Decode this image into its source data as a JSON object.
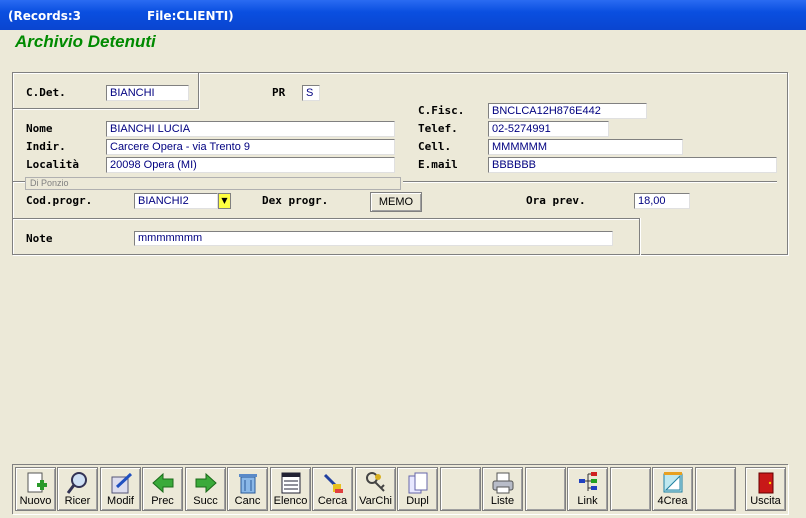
{
  "titlebar": {
    "records": "(Records:3",
    "file": "File:CLIENTI)"
  },
  "app_title": "Archivio Detenuti",
  "form": {
    "cdet_label": "C.Det.",
    "cdet_value": "BIANCHI",
    "pr_label": "PR",
    "pr_value": "S",
    "cfisc_label": "C.Fisc.",
    "cfisc_value": "BNCLCA12H876E442",
    "nome_label": "Nome",
    "nome_value": "BIANCHI LUCIA",
    "telef_label": "Telef.",
    "telef_value": "02-5274991",
    "indir_label": "Indir.",
    "indir_value": "Carcere Opera - via Trento 9",
    "cell_label": "Cell.",
    "cell_value": "MMMMMM",
    "localita_label": "Località",
    "localita_value": "20098  Opera (MI)",
    "email_label": "E.mail",
    "email_value": "BBBBBB",
    "group_caption": "Di Ponzio",
    "codprogr_label": "Cod.progr.",
    "codprogr_value": "BIANCHI2",
    "dexprogr_label": "Dex progr.",
    "memo_label": "MEMO",
    "oraprev_label": "Ora prev.",
    "oraprev_value": "18,00",
    "note_label": "Note",
    "note_value": "mmmmmmm"
  },
  "toolbar": {
    "buttons": [
      {
        "label": "Nuovo",
        "icon": "new-document-icon"
      },
      {
        "label": "Ricer",
        "icon": "magnifier-icon"
      },
      {
        "label": "Modif",
        "icon": "edit-document-icon"
      },
      {
        "label": "Prec",
        "icon": "arrow-left-icon"
      },
      {
        "label": "Succ",
        "icon": "arrow-right-icon"
      },
      {
        "label": "Canc",
        "icon": "trash-icon"
      },
      {
        "label": "Elenco",
        "icon": "list-icon"
      },
      {
        "label": "Cerca",
        "icon": "find-icon"
      },
      {
        "label": "VarChi",
        "icon": "keys-icon"
      },
      {
        "label": "Dupl",
        "icon": "copy-icon"
      },
      {
        "label": "",
        "icon": ""
      },
      {
        "label": "Liste",
        "icon": "printer-icon"
      },
      {
        "label": "",
        "icon": ""
      },
      {
        "label": "Link",
        "icon": "tree-icon"
      },
      {
        "label": "",
        "icon": ""
      },
      {
        "label": "4Crea",
        "icon": "design-icon"
      },
      {
        "label": "",
        "icon": ""
      },
      {
        "label": "Uscita",
        "icon": "exit-door-icon"
      }
    ]
  }
}
